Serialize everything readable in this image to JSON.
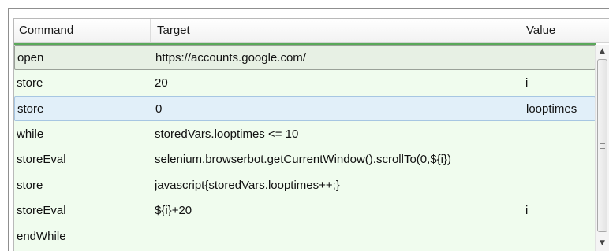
{
  "columns": {
    "command": "Command",
    "target": "Target",
    "value": "Value"
  },
  "rows": [
    {
      "command": "open",
      "target": "https://accounts.google.com/",
      "value": "",
      "state": "current"
    },
    {
      "command": "store",
      "target": "20",
      "value": "i",
      "state": ""
    },
    {
      "command": "store",
      "target": "0",
      "value": "looptimes",
      "state": "selected"
    },
    {
      "command": "while",
      "target": "storedVars.looptimes <= 10",
      "value": "",
      "state": ""
    },
    {
      "command": "storeEval",
      "target": "selenium.browserbot.getCurrentWindow().scrollTo(0,${i})",
      "value": "",
      "state": ""
    },
    {
      "command": "store",
      "target": "javascript{storedVars.looptimes++;}",
      "value": "",
      "state": ""
    },
    {
      "command": "storeEval",
      "target": "${i}+20",
      "value": "i",
      "state": ""
    },
    {
      "command": "endWhile",
      "target": "",
      "value": "",
      "state": ""
    }
  ],
  "scrollbar": {
    "up_icon": "scroll-up-arrow-icon",
    "down_icon": "scroll-down-arrow-icon"
  },
  "colors": {
    "row_background": "#f0fcee",
    "current_row": "#e7f0e4",
    "selected_row": "#e1eff9",
    "executed_line": "#5aa85a"
  }
}
